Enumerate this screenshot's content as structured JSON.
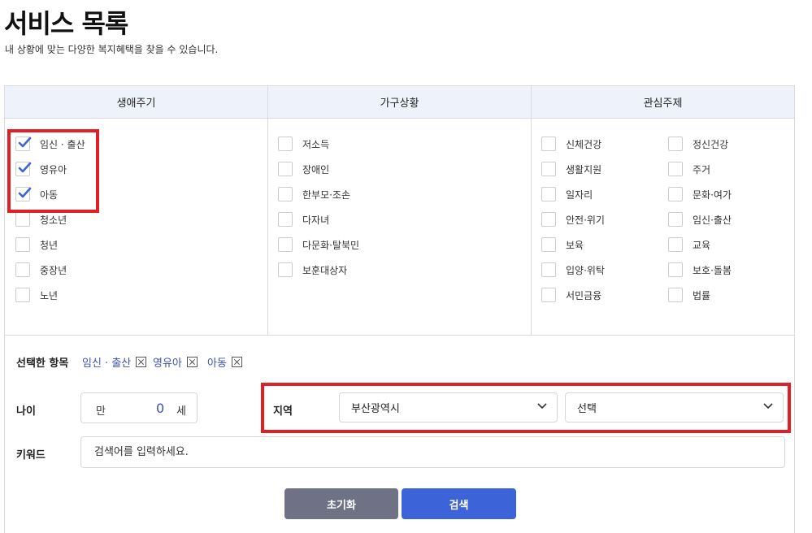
{
  "page": {
    "title": "서비스 목록",
    "subtitle": "내 상황에 맞는 다양한 복지혜택을 찾을 수 있습니다."
  },
  "columns": {
    "life_cycle": {
      "header": "생애주기",
      "items": [
        {
          "label": "임신 · 출산",
          "checked": true
        },
        {
          "label": "영유아",
          "checked": true
        },
        {
          "label": "아동",
          "checked": true
        },
        {
          "label": "청소년",
          "checked": false
        },
        {
          "label": "청년",
          "checked": false
        },
        {
          "label": "중장년",
          "checked": false
        },
        {
          "label": "노년",
          "checked": false
        }
      ]
    },
    "household": {
      "header": "가구상황",
      "items": [
        {
          "label": "저소득",
          "checked": false
        },
        {
          "label": "장애인",
          "checked": false
        },
        {
          "label": "한부모·조손",
          "checked": false
        },
        {
          "label": "다자녀",
          "checked": false
        },
        {
          "label": "다문화·탈북민",
          "checked": false
        },
        {
          "label": "보훈대상자",
          "checked": false
        }
      ]
    },
    "interest": {
      "header": "관심주제",
      "items_left": [
        {
          "label": "신체건강",
          "checked": false
        },
        {
          "label": "생활지원",
          "checked": false
        },
        {
          "label": "일자리",
          "checked": false
        },
        {
          "label": "안전·위기",
          "checked": false
        },
        {
          "label": "보육",
          "checked": false
        },
        {
          "label": "입양·위탁",
          "checked": false
        },
        {
          "label": "서민금융",
          "checked": false
        }
      ],
      "items_right": [
        {
          "label": "정신건강",
          "checked": false
        },
        {
          "label": "주거",
          "checked": false
        },
        {
          "label": "문화·여가",
          "checked": false
        },
        {
          "label": "임신·출산",
          "checked": false
        },
        {
          "label": "교육",
          "checked": false
        },
        {
          "label": "보호·돌봄",
          "checked": false
        },
        {
          "label": "법률",
          "checked": false
        }
      ]
    }
  },
  "selected": {
    "label": "선택한 항목",
    "chips": [
      "임신 · 출산",
      "영유아",
      "아동"
    ]
  },
  "age": {
    "label": "나이",
    "prefix": "만",
    "value": "0",
    "suffix": "세"
  },
  "region": {
    "label": "지역",
    "city": "부산광역시",
    "district": "선택"
  },
  "keyword": {
    "label": "키워드",
    "placeholder": "검색어를 입력하세요."
  },
  "buttons": {
    "reset": "초기화",
    "search": "검색"
  },
  "colors": {
    "accent": "#3d63d8",
    "chip_text": "#3f51b5",
    "highlight": "#e01f26",
    "header_bg": "#eef2fb",
    "reset_button": "#6e7284"
  }
}
